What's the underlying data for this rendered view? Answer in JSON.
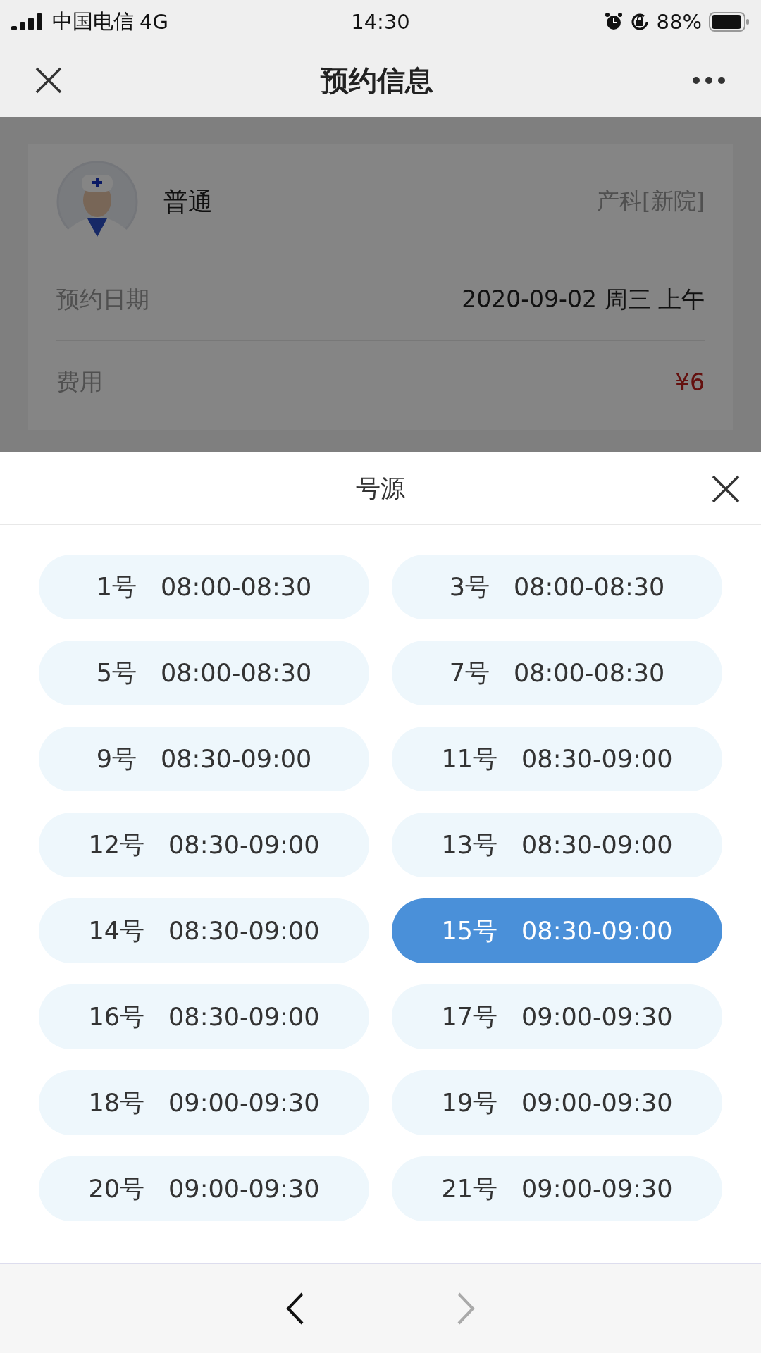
{
  "status_bar": {
    "carrier": "中国电信",
    "network": "4G",
    "time": "14:30",
    "battery": "88%"
  },
  "nav": {
    "title": "预约信息"
  },
  "card": {
    "doctor": "普通",
    "department": "产科[新院]",
    "rows": [
      {
        "label": "预约日期",
        "value": "2020-09-02 周三 上午",
        "kind": "plain"
      },
      {
        "label": "费用",
        "value": "¥6",
        "kind": "price"
      }
    ]
  },
  "sheet": {
    "title": "号源",
    "slots": [
      {
        "number": "1号",
        "time": "08:00-08:30",
        "selected": false
      },
      {
        "number": "3号",
        "time": "08:00-08:30",
        "selected": false
      },
      {
        "number": "5号",
        "time": "08:00-08:30",
        "selected": false
      },
      {
        "number": "7号",
        "time": "08:00-08:30",
        "selected": false
      },
      {
        "number": "9号",
        "time": "08:30-09:00",
        "selected": false
      },
      {
        "number": "11号",
        "time": "08:30-09:00",
        "selected": false
      },
      {
        "number": "12号",
        "time": "08:30-09:00",
        "selected": false
      },
      {
        "number": "13号",
        "time": "08:30-09:00",
        "selected": false
      },
      {
        "number": "14号",
        "time": "08:30-09:00",
        "selected": false
      },
      {
        "number": "15号",
        "time": "08:30-09:00",
        "selected": true
      },
      {
        "number": "16号",
        "time": "08:30-09:00",
        "selected": false
      },
      {
        "number": "17号",
        "time": "09:00-09:30",
        "selected": false
      },
      {
        "number": "18号",
        "time": "09:00-09:30",
        "selected": false
      },
      {
        "number": "19号",
        "time": "09:00-09:30",
        "selected": false
      },
      {
        "number": "20号",
        "time": "09:00-09:30",
        "selected": false
      },
      {
        "number": "21号",
        "time": "09:00-09:30",
        "selected": false
      }
    ]
  },
  "bottom_bar": {
    "back_disabled": false,
    "forward_disabled": true
  }
}
